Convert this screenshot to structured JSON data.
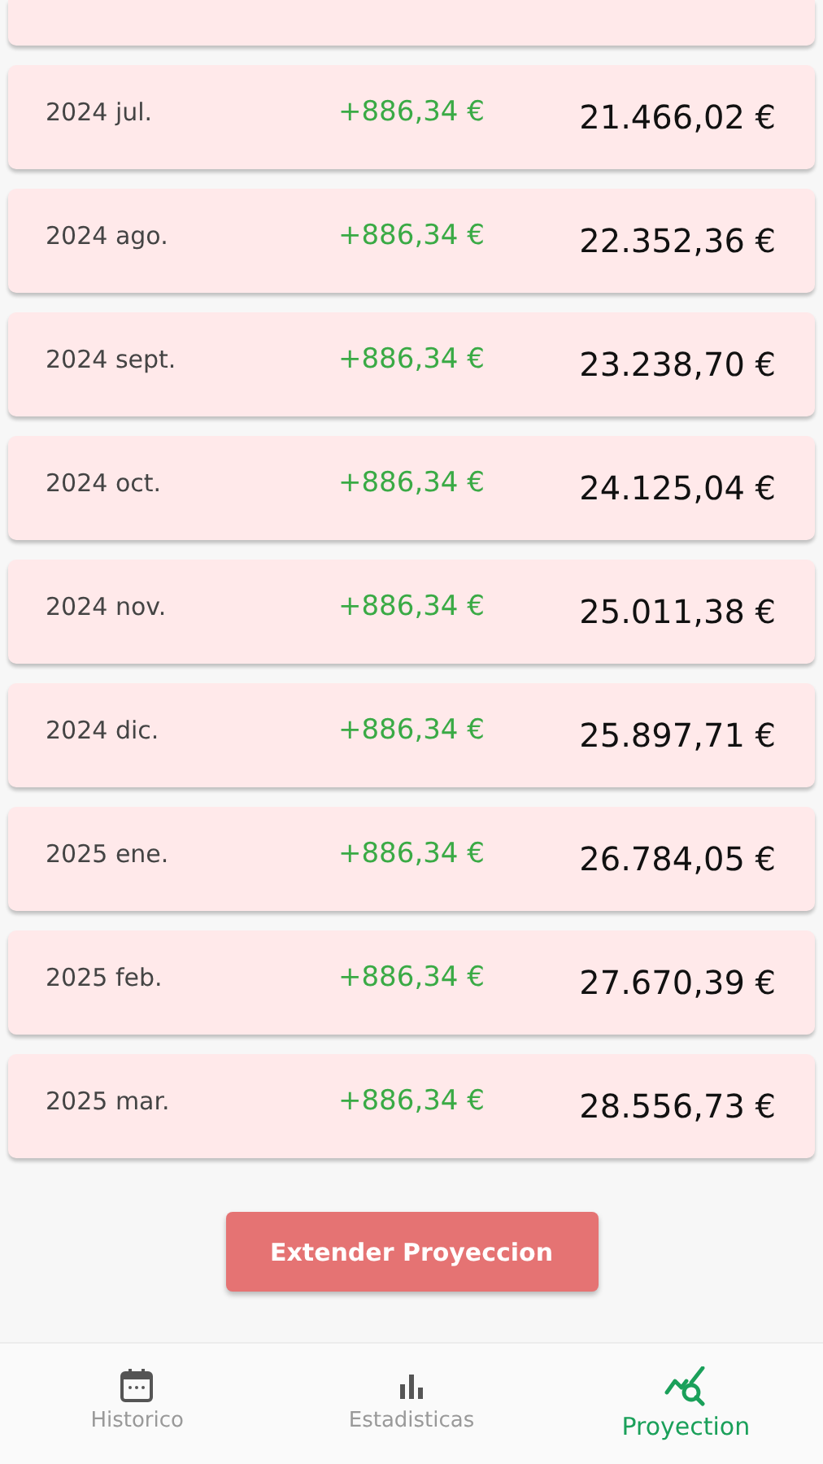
{
  "projection_rows": [
    {
      "month": "2024 jul.",
      "change": "+886,34 €",
      "total": "21.466,02 €"
    },
    {
      "month": "2024 ago.",
      "change": "+886,34 €",
      "total": "22.352,36 €"
    },
    {
      "month": "2024 sept.",
      "change": "+886,34 €",
      "total": "23.238,70 €"
    },
    {
      "month": "2024 oct.",
      "change": "+886,34 €",
      "total": "24.125,04 €"
    },
    {
      "month": "2024 nov.",
      "change": "+886,34 €",
      "total": "25.011,38 €"
    },
    {
      "month": "2024 dic.",
      "change": "+886,34 €",
      "total": "25.897,71 €"
    },
    {
      "month": "2025 ene.",
      "change": "+886,34 €",
      "total": "26.784,05 €"
    },
    {
      "month": "2025 feb.",
      "change": "+886,34 €",
      "total": "27.670,39 €"
    },
    {
      "month": "2025 mar.",
      "change": "+886,34 €",
      "total": "28.556,73 €"
    }
  ],
  "extend_button": "Extender Proyeccion",
  "bottom_nav": [
    {
      "kind": "calendar",
      "label": "Historico",
      "selected": false
    },
    {
      "kind": "bars",
      "label": "Estadisticas",
      "selected": false
    },
    {
      "kind": "trend",
      "label": "Proyection",
      "selected": true
    }
  ]
}
